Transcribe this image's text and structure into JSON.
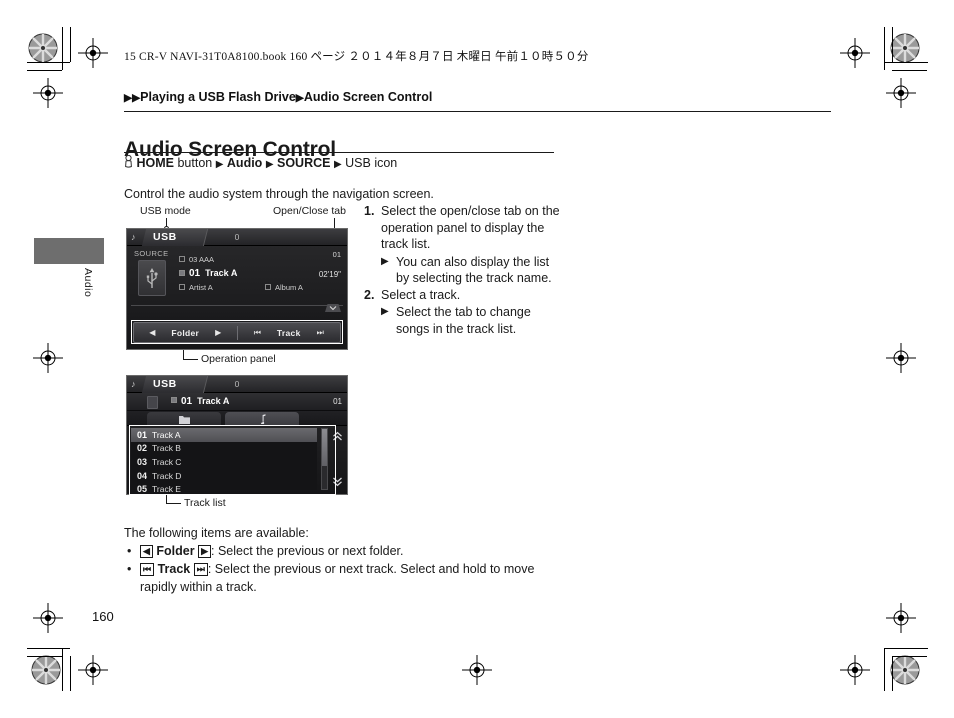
{
  "book_line": "15 CR-V NAVI-31T0A8100.book   160 ページ   ２０１４年８月７日   木曜日   午前１０時５０分",
  "breadcrumb": {
    "part1": "Playing a USB Flash Drive",
    "part2": "Audio Screen Control"
  },
  "page_title": "Audio Screen Control",
  "nav_path": {
    "home": "HOME",
    "button_word": "button",
    "audio": "Audio",
    "source": "SOURCE",
    "usb_icon": "USB icon"
  },
  "intro": "Control the audio system through the navigation screen.",
  "sidebar": {
    "tab_label": "Audio"
  },
  "callouts": {
    "usb_mode": "USB mode",
    "open_close_tab": "Open/Close tab",
    "operation_panel": "Operation panel",
    "track_list": "Track list"
  },
  "screen1": {
    "tab_label": "USB",
    "clock": "0",
    "source_label": "SOURCE",
    "row_folder": "03  AAA",
    "row_track_num": "01",
    "row_track_name": "Track A",
    "row_artist": "Artist A",
    "row_album": "Album A",
    "track_indicator": "01",
    "elapsed_time": "02'19\"",
    "panel": {
      "prev_folder": "◀",
      "folder_label": "Folder",
      "next_folder": "▶",
      "prev_track": "⏮",
      "track_label": "Track",
      "next_track": "⏭"
    }
  },
  "screen2": {
    "tab_label": "USB",
    "clock": "0",
    "now_playing_num": "01",
    "now_playing_name": "Track A",
    "track_indicator": "01",
    "tab_folder_icon": "folder-icon",
    "tab_music_icon": "music-note-icon",
    "tracks": [
      {
        "num": "01",
        "name": "Track A",
        "selected": true
      },
      {
        "num": "02",
        "name": "Track B",
        "selected": false
      },
      {
        "num": "03",
        "name": "Track C",
        "selected": false
      },
      {
        "num": "04",
        "name": "Track D",
        "selected": false
      },
      {
        "num": "05",
        "name": "Track E",
        "selected": false
      }
    ]
  },
  "steps": [
    {
      "number": "1.",
      "text": "Select the open/close tab on the operation panel to display the track list.",
      "sub": "You can also display the list by selecting the track name."
    },
    {
      "number": "2.",
      "text": "Select a track.",
      "sub": "Select the tab to change songs in the track list."
    }
  ],
  "bottom": {
    "lead_in": "The following items are available:",
    "items": [
      {
        "cap_left": "◀",
        "label": "Folder",
        "cap_right": "▶",
        "text": ": Select the previous or next folder."
      },
      {
        "cap_left": "⏮",
        "label": "Track",
        "cap_right": "⏭",
        "text": ": Select the previous or next track. Select and hold to move rapidly within a track."
      }
    ]
  },
  "page_number": "160",
  "colors": {
    "accent_tab": "#6e6e6e",
    "screen_bg": "#1a1a1c",
    "highlight": "#6a6a6e"
  }
}
